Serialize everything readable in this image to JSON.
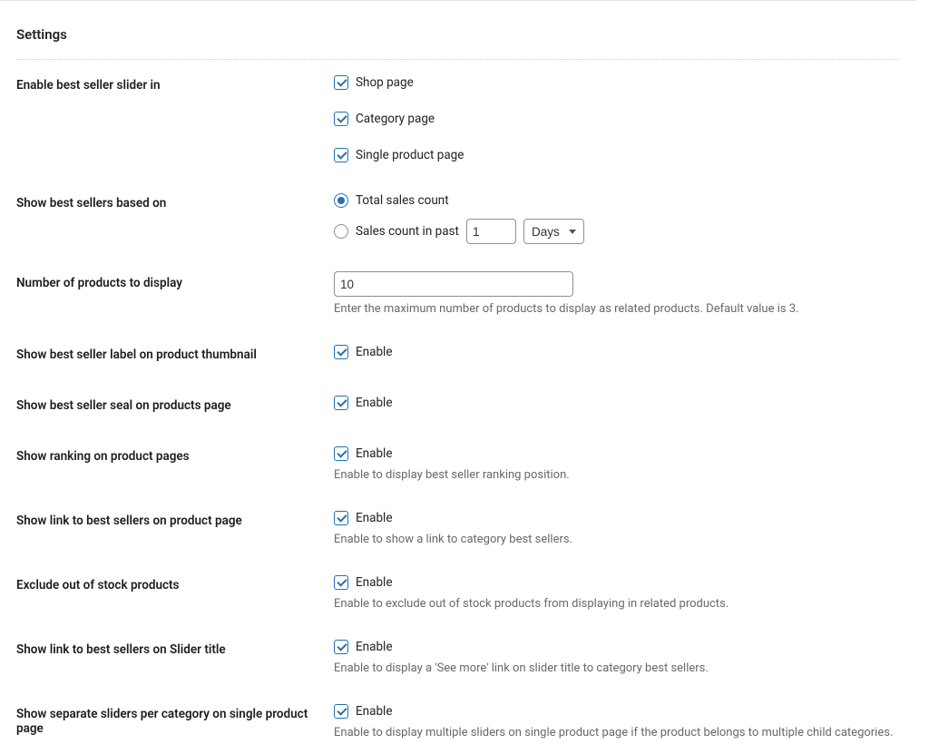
{
  "page_title": "Settings",
  "fields": {
    "enable_slider_in": {
      "label": "Enable best seller slider in",
      "options": {
        "shop": "Shop page",
        "category": "Category page",
        "single": "Single product page"
      }
    },
    "basis": {
      "label": "Show best sellers based on",
      "total": "Total sales count",
      "past": "Sales count in past",
      "past_value": "1",
      "unit": "Days"
    },
    "num_products": {
      "label": "Number of products to display",
      "value": "10",
      "desc": "Enter the maximum number of products to display as related products. Default value is 3."
    },
    "thumb_label": {
      "label": "Show best seller label on product thumbnail",
      "option": "Enable"
    },
    "seal": {
      "label": "Show best seller seal on products page",
      "option": "Enable"
    },
    "ranking": {
      "label": "Show ranking on product pages",
      "option": "Enable",
      "desc": "Enable to display best seller ranking position."
    },
    "link_product": {
      "label": "Show link to best sellers on product page",
      "option": "Enable",
      "desc": "Enable to show a link to category best sellers."
    },
    "exclude_oos": {
      "label": "Exclude out of stock products",
      "option": "Enable",
      "desc": "Enable to exclude out of stock products from displaying in related products."
    },
    "link_slider_title": {
      "label": "Show link to best sellers on Slider title",
      "option": "Enable",
      "desc": "Enable to display a 'See more' link on slider title to category best sellers."
    },
    "separate_sliders": {
      "label": "Show separate sliders per category on single product page",
      "option": "Enable",
      "desc": "Enable to display multiple sliders on single product page if the product belongs to multiple child categories."
    }
  }
}
